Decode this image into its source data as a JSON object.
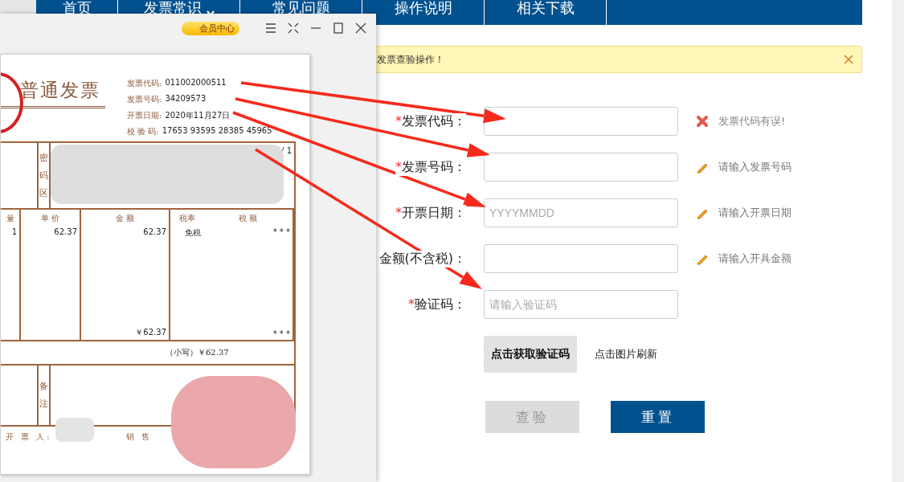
{
  "nav": [
    {
      "label": "首页",
      "dropdown": false
    },
    {
      "label": "发票常识",
      "dropdown": true
    },
    {
      "label": "常见问题",
      "dropdown": false
    },
    {
      "label": "操作说明",
      "dropdown": false
    },
    {
      "label": "相关下载",
      "dropdown": false
    }
  ],
  "alert": {
    "text": "发票查验操作！"
  },
  "form": {
    "fields": [
      {
        "label": "发票代码：",
        "required": true,
        "hint": {
          "kind": "error",
          "text": "发票代码有误!"
        }
      },
      {
        "label": "发票号码：",
        "required": true,
        "hint": {
          "kind": "edit",
          "text": "请输入发票号码"
        }
      },
      {
        "label": "开票日期：",
        "required": true,
        "placeholder": "YYYYMMDD",
        "hint": {
          "kind": "edit",
          "text": "请输入开票日期"
        }
      },
      {
        "label": "金额(不含税)：",
        "required": false,
        "hint": {
          "kind": "edit",
          "text": "请输入开具金额"
        }
      },
      {
        "label": "验证码：",
        "required": true,
        "placeholder": "请输入验证码"
      }
    ],
    "required_mark": "*",
    "captcha": {
      "image_text": "点击获取验证码",
      "refresh_hint": "点击图片刷新"
    },
    "buttons": [
      {
        "label": "查验",
        "disabled": true
      },
      {
        "label": "重置",
        "disabled": false
      }
    ]
  },
  "viewer": {
    "member_badge": "会员中心",
    "invoice": {
      "title": "普通发票",
      "info": [
        {
          "label": "发票代码:",
          "value": "011002000511"
        },
        {
          "label": "发票号码:",
          "value": "34209573"
        },
        {
          "label": "开票日期:",
          "value": "2020年11月27日"
        },
        {
          "label": "校 验 码:",
          "value": "17653 93595 28385 45965"
        }
      ],
      "cipher_label": "密码区",
      "cipher_text": "/ 1",
      "columns": [
        {
          "header": "量",
          "value": "1"
        },
        {
          "header": "单 价",
          "value": "62.37"
        },
        {
          "header": "金 额",
          "value": "62.37",
          "total": "￥62.37"
        },
        {
          "header": "税率",
          "value": "免税"
        },
        {
          "header": "税 额",
          "value": "* * *",
          "total": "* * *"
        }
      ],
      "subtotal": "（小写）￥62.37",
      "remarks_label": "备注",
      "issuer_label": "开 票 人:",
      "seller_label": "销 售"
    }
  }
}
